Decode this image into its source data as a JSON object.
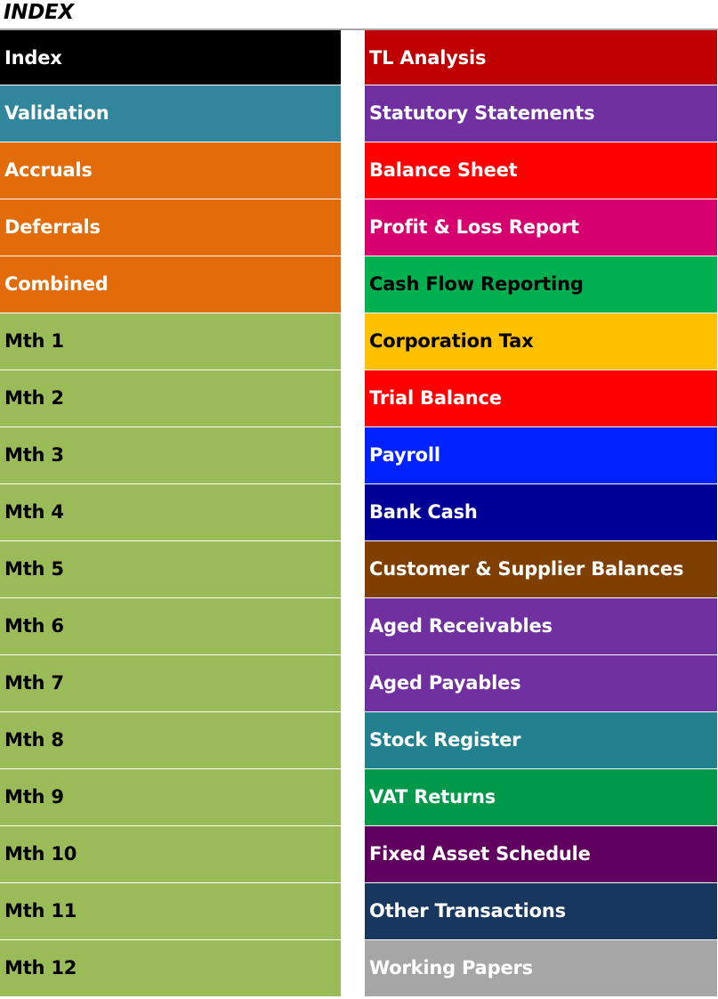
{
  "title": "INDEX",
  "left_items": [
    {
      "label": "Index",
      "bg": "#000000",
      "fg": "#ffffff"
    },
    {
      "label": "Validation",
      "bg": "#31869b",
      "fg": "#ffffff"
    },
    {
      "label": "Accruals",
      "bg": "#e26b0a",
      "fg": "#ffffff"
    },
    {
      "label": "Deferrals",
      "bg": "#e26b0a",
      "fg": "#ffffff"
    },
    {
      "label": "Combined",
      "bg": "#e26b0a",
      "fg": "#ffffff"
    },
    {
      "label": "Mth 1",
      "bg": "#9bbb59",
      "fg": "#000000"
    },
    {
      "label": "Mth 2",
      "bg": "#9bbb59",
      "fg": "#000000"
    },
    {
      "label": "Mth 3",
      "bg": "#9bbb59",
      "fg": "#000000"
    },
    {
      "label": "Mth 4",
      "bg": "#9bbb59",
      "fg": "#000000"
    },
    {
      "label": "Mth 5",
      "bg": "#9bbb59",
      "fg": "#000000"
    },
    {
      "label": "Mth 6",
      "bg": "#9bbb59",
      "fg": "#000000"
    },
    {
      "label": "Mth 7",
      "bg": "#9bbb59",
      "fg": "#000000"
    },
    {
      "label": "Mth 8",
      "bg": "#9bbb59",
      "fg": "#000000"
    },
    {
      "label": "Mth 9",
      "bg": "#9bbb59",
      "fg": "#000000"
    },
    {
      "label": "Mth 10",
      "bg": "#9bbb59",
      "fg": "#000000"
    },
    {
      "label": "Mth 11",
      "bg": "#9bbb59",
      "fg": "#000000"
    },
    {
      "label": "Mth 12",
      "bg": "#9bbb59",
      "fg": "#000000"
    }
  ],
  "right_items": [
    {
      "label": "TL Analysis",
      "bg": "#c00000",
      "fg": "#ffffff"
    },
    {
      "label": "Statutory Statements",
      "bg": "#7030a0",
      "fg": "#ffffff"
    },
    {
      "label": "Balance Sheet",
      "bg": "#ff0000",
      "fg": "#ffffff"
    },
    {
      "label": "Profit & Loss Report",
      "bg": "#d6006f",
      "fg": "#ffffff"
    },
    {
      "label": "Cash Flow Reporting",
      "bg": "#00b050",
      "fg": "#000000"
    },
    {
      "label": "Corporation Tax",
      "bg": "#ffc000",
      "fg": "#000000"
    },
    {
      "label": "Trial Balance",
      "bg": "#ff0000",
      "fg": "#ffffff"
    },
    {
      "label": "Payroll",
      "bg": "#0022ff",
      "fg": "#ffffff"
    },
    {
      "label": "Bank Cash",
      "bg": "#000096",
      "fg": "#ffffff"
    },
    {
      "label": "Customer & Supplier Balances",
      "bg": "#7f3f00",
      "fg": "#ffffff"
    },
    {
      "label": "Aged Receivables",
      "bg": "#7030a0",
      "fg": "#ffffff"
    },
    {
      "label": "Aged Payables",
      "bg": "#7030a0",
      "fg": "#ffffff"
    },
    {
      "label": "Stock Register",
      "bg": "#23818f",
      "fg": "#ffffff"
    },
    {
      "label": "VAT Returns",
      "bg": "#00994a",
      "fg": "#ffffff"
    },
    {
      "label": "Fixed Asset Schedule",
      "bg": "#60005e",
      "fg": "#ffffff"
    },
    {
      "label": "Other Transactions",
      "bg": "#17375e",
      "fg": "#ffffff"
    },
    {
      "label": "Working Papers",
      "bg": "#a6a6a6",
      "fg": "#ffffff"
    }
  ]
}
